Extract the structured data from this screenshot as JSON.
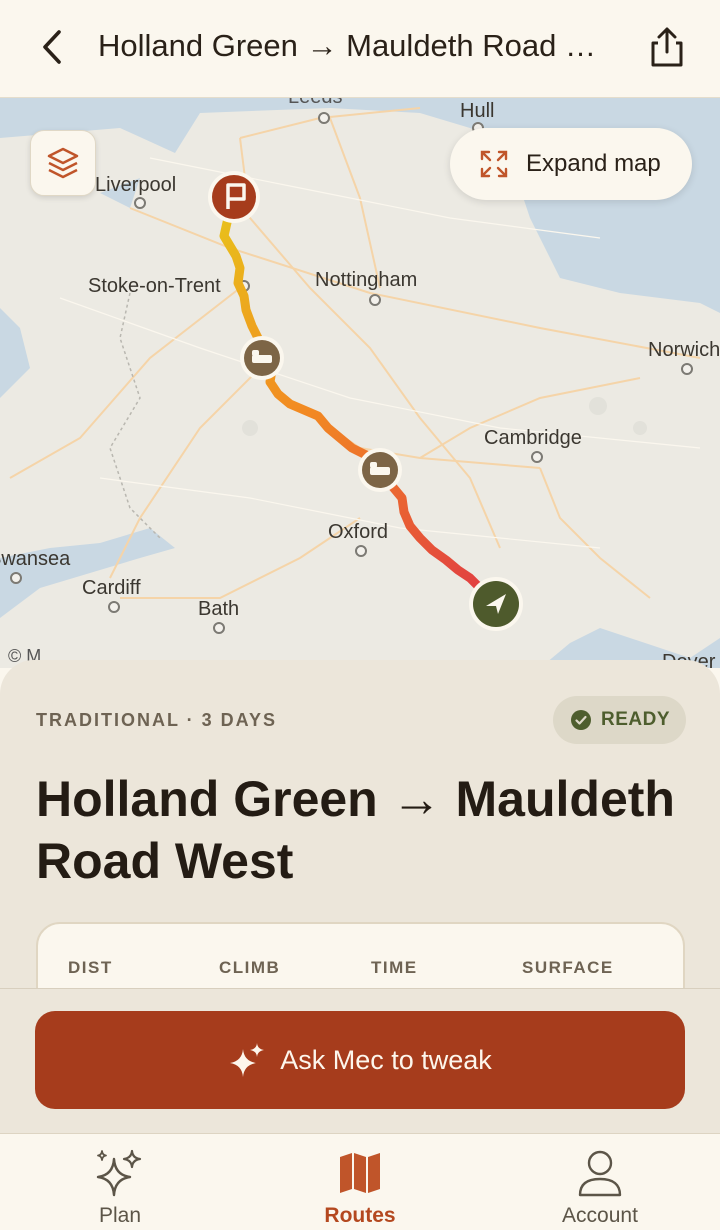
{
  "header": {
    "title": "Holland Green → Mauldeth Road …",
    "back_icon": "chevron-left-icon",
    "share_icon": "share-icon"
  },
  "map": {
    "expand_label": "Expand map",
    "layers_icon": "layers-icon",
    "expand_icon": "expand-icon",
    "attribution": "© M",
    "cities": [
      "Leeds",
      "Hull",
      "Liverpool",
      "Stoke-on-Trent",
      "Nottingham",
      "Norwich",
      "Cambridge",
      "Oxford",
      "Swansea",
      "Cardiff",
      "Bath",
      "Dover"
    ],
    "colors": {
      "route_start": "#e8c21a",
      "route_mid": "#f28a22",
      "route_end": "#e03a44",
      "start_pin": "#a63c1c",
      "stop_pin": "#7d6546",
      "end_pin": "#4e5a2c"
    }
  },
  "route": {
    "meta": "TRADITIONAL · 3 DAYS",
    "status": "READY",
    "title": "Holland Green → Mauldeth Road West",
    "stat_headers": [
      "DIST",
      "CLIMB",
      "TIME",
      "SURFACE"
    ]
  },
  "action": {
    "ask_label": "Ask Mec to tweak",
    "ask_icon": "sparkles-icon"
  },
  "tabs": [
    {
      "label": "Plan",
      "icon": "sparkles-icon",
      "active": false
    },
    {
      "label": "Routes",
      "icon": "map-icon",
      "active": true
    },
    {
      "label": "Account",
      "icon": "user-icon",
      "active": false
    }
  ],
  "colors": {
    "accent": "#a63c1c",
    "background": "#fbf7ee",
    "sheet": "#ece6da",
    "ready": "#4e5e2e"
  }
}
